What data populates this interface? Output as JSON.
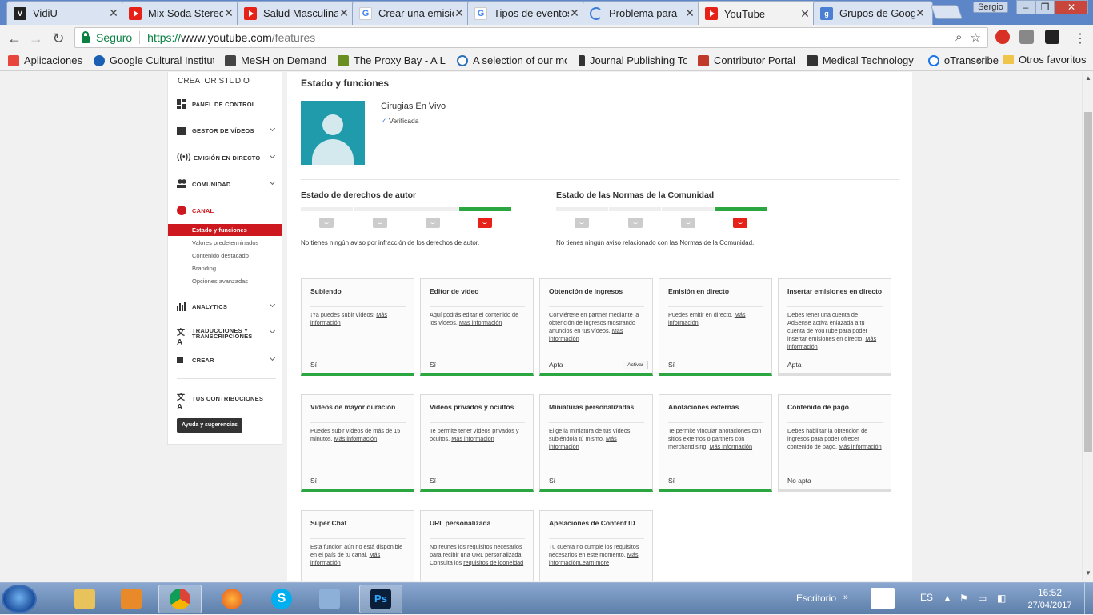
{
  "browser": {
    "tabs": [
      {
        "title": "VidiU",
        "icon": "vidiu-icon",
        "active": false
      },
      {
        "title": "Mix Soda Stereo",
        "icon": "youtube-icon",
        "active": false
      },
      {
        "title": "Salud Masculina",
        "icon": "youtube-icon",
        "active": false
      },
      {
        "title": "Crear una emisión",
        "icon": "google-icon",
        "active": false
      },
      {
        "title": "Tipos de eventos",
        "icon": "google-icon",
        "active": false
      },
      {
        "title": "Problema para",
        "icon": "loading-icon",
        "active": false
      },
      {
        "title": "YouTube",
        "icon": "youtube-icon",
        "active": true
      },
      {
        "title": "Grupos de Google",
        "icon": "google-groups-icon",
        "active": false
      }
    ],
    "profile": "Sergio",
    "omnibox": {
      "secure_label": "Seguro",
      "protocol": "https://",
      "host": "www.youtube.com",
      "path": "/features"
    },
    "bookmarks": [
      {
        "label": "Aplicaciones",
        "color": "#e8453c"
      },
      {
        "label": "Google Cultural Institute",
        "color": "#1a5fb4"
      },
      {
        "label": "MeSH on Demand",
        "color": "#444444"
      },
      {
        "label": "The Proxy Bay - A List",
        "color": "#6b8e23"
      },
      {
        "label": "A selection of our most",
        "color": "#2a6fb5"
      },
      {
        "label": "Journal Publishing Tools",
        "color": "#333333"
      },
      {
        "label": "Contributor Portal",
        "color": "#c0392b"
      },
      {
        "label": "Medical Technology News",
        "color": "#333333"
      },
      {
        "label": "oTranscribe",
        "color": "#1a73e8"
      }
    ],
    "bookmarks_more": "»",
    "other_bookmarks": "Otros favoritos"
  },
  "sidebar": {
    "studio_label": "CREATOR STUDIO",
    "items": [
      {
        "label": "PANEL DE CONTROL",
        "icon": "dashboard-icon"
      },
      {
        "label": "GESTOR DE VÍDEOS",
        "icon": "video-manager-icon"
      },
      {
        "label": "EMISIÓN EN DIRECTO",
        "icon": "live-icon"
      },
      {
        "label": "COMUNIDAD",
        "icon": "community-icon"
      },
      {
        "label": "CANAL",
        "icon": "channel-icon"
      },
      {
        "label": "ANALYTICS",
        "icon": "analytics-icon"
      },
      {
        "label": "TRADUCCIONES Y TRANSCRIPCIONES",
        "icon": "translate-icon"
      },
      {
        "label": "CREAR",
        "icon": "create-icon"
      },
      {
        "label": "TUS CONTRIBUCIONES",
        "icon": "contributions-icon"
      }
    ],
    "channel_subitems": [
      "Estado y funciones",
      "Valores predeterminados",
      "Contenido destacado",
      "Branding",
      "Opciones avanzadas"
    ],
    "help_button": "Ayuda y sugerencias"
  },
  "main": {
    "title": "Estado y funciones",
    "channel_name": "Cirugias En Vivo",
    "verified_label": "Verificada",
    "copyright": {
      "title": "Estado de derechos de autor",
      "text": "No tienes ningún aviso por infracción de los derechos de autor."
    },
    "community": {
      "title": "Estado de las Normas de la Comunidad",
      "text": "No tienes ningún aviso relacionado con las Normas de la Comunidad."
    },
    "cards": [
      {
        "title": "Subiendo",
        "desc": "¡Ya puedes subir vídeos! ",
        "link": "Más información",
        "status": "Sí",
        "ok": true
      },
      {
        "title": "Editor de vídeo",
        "desc": "Aquí podrás editar el contenido de los vídeos. ",
        "link": "Más información",
        "status": "Sí",
        "ok": true
      },
      {
        "title": "Obtención de ingresos",
        "desc": "Conviértete en partner mediante la obtención de ingresos mostrando anuncios en tus vídeos. ",
        "link": "Más información",
        "status": "Apta",
        "ok": true,
        "button": "Activar"
      },
      {
        "title": "Emisión en directo",
        "desc": "Puedes emitir en directo. ",
        "link": "Más información",
        "status": "Sí",
        "ok": true
      },
      {
        "title": "Insertar emisiones en directo",
        "desc": "Debes tener una cuenta de AdSense activa enlazada a tu cuenta de YouTube para poder insertar emisiones en directo. ",
        "link": "Más información",
        "status": "Apta",
        "ok": false
      },
      {
        "title": "Vídeos de mayor duración",
        "desc": "Puedes subir vídeos de más de 15 minutos. ",
        "link": "Más información",
        "status": "Sí",
        "ok": true
      },
      {
        "title": "Vídeos privados y ocultos",
        "desc": "Te permite tener vídeos privados y ocultos. ",
        "link": "Más información",
        "status": "Sí",
        "ok": true
      },
      {
        "title": "Miniaturas personalizadas",
        "desc": "Elige la miniatura de tus vídeos subiéndola tú mismo. ",
        "link": "Más información",
        "status": "Sí",
        "ok": true
      },
      {
        "title": "Anotaciones externas",
        "desc": "Te permite vincular anotaciones con sitios externos o partners con merchandising. ",
        "link": "Más información",
        "status": "Sí",
        "ok": true
      },
      {
        "title": "Contenido de pago",
        "desc": "Debes habilitar la obtención de ingresos para poder ofrecer contenido de pago. ",
        "link": "Más información",
        "status": "No apta",
        "ok": false
      },
      {
        "title": "Super Chat",
        "desc": "Esta función aún no está disponible en el país de tu canal. ",
        "link": "Más información",
        "status": "",
        "ok": false
      },
      {
        "title": "URL personalizada",
        "desc": "No reúnes los requisitos necesarios para recibir una URL personalizada. Consulta los ",
        "link": "requisitos de idoneidad",
        "status": "",
        "ok": false
      },
      {
        "title": "Apelaciones de Content ID",
        "desc": "Tu cuenta no cumple los requisitos necesarios en este momento. ",
        "link": "Más informaciónLearn more",
        "status": "",
        "ok": false
      }
    ]
  },
  "taskbar": {
    "desktop_label": "Escritorio",
    "language": "ES",
    "time": "16:52",
    "date": "27/04/2017"
  }
}
